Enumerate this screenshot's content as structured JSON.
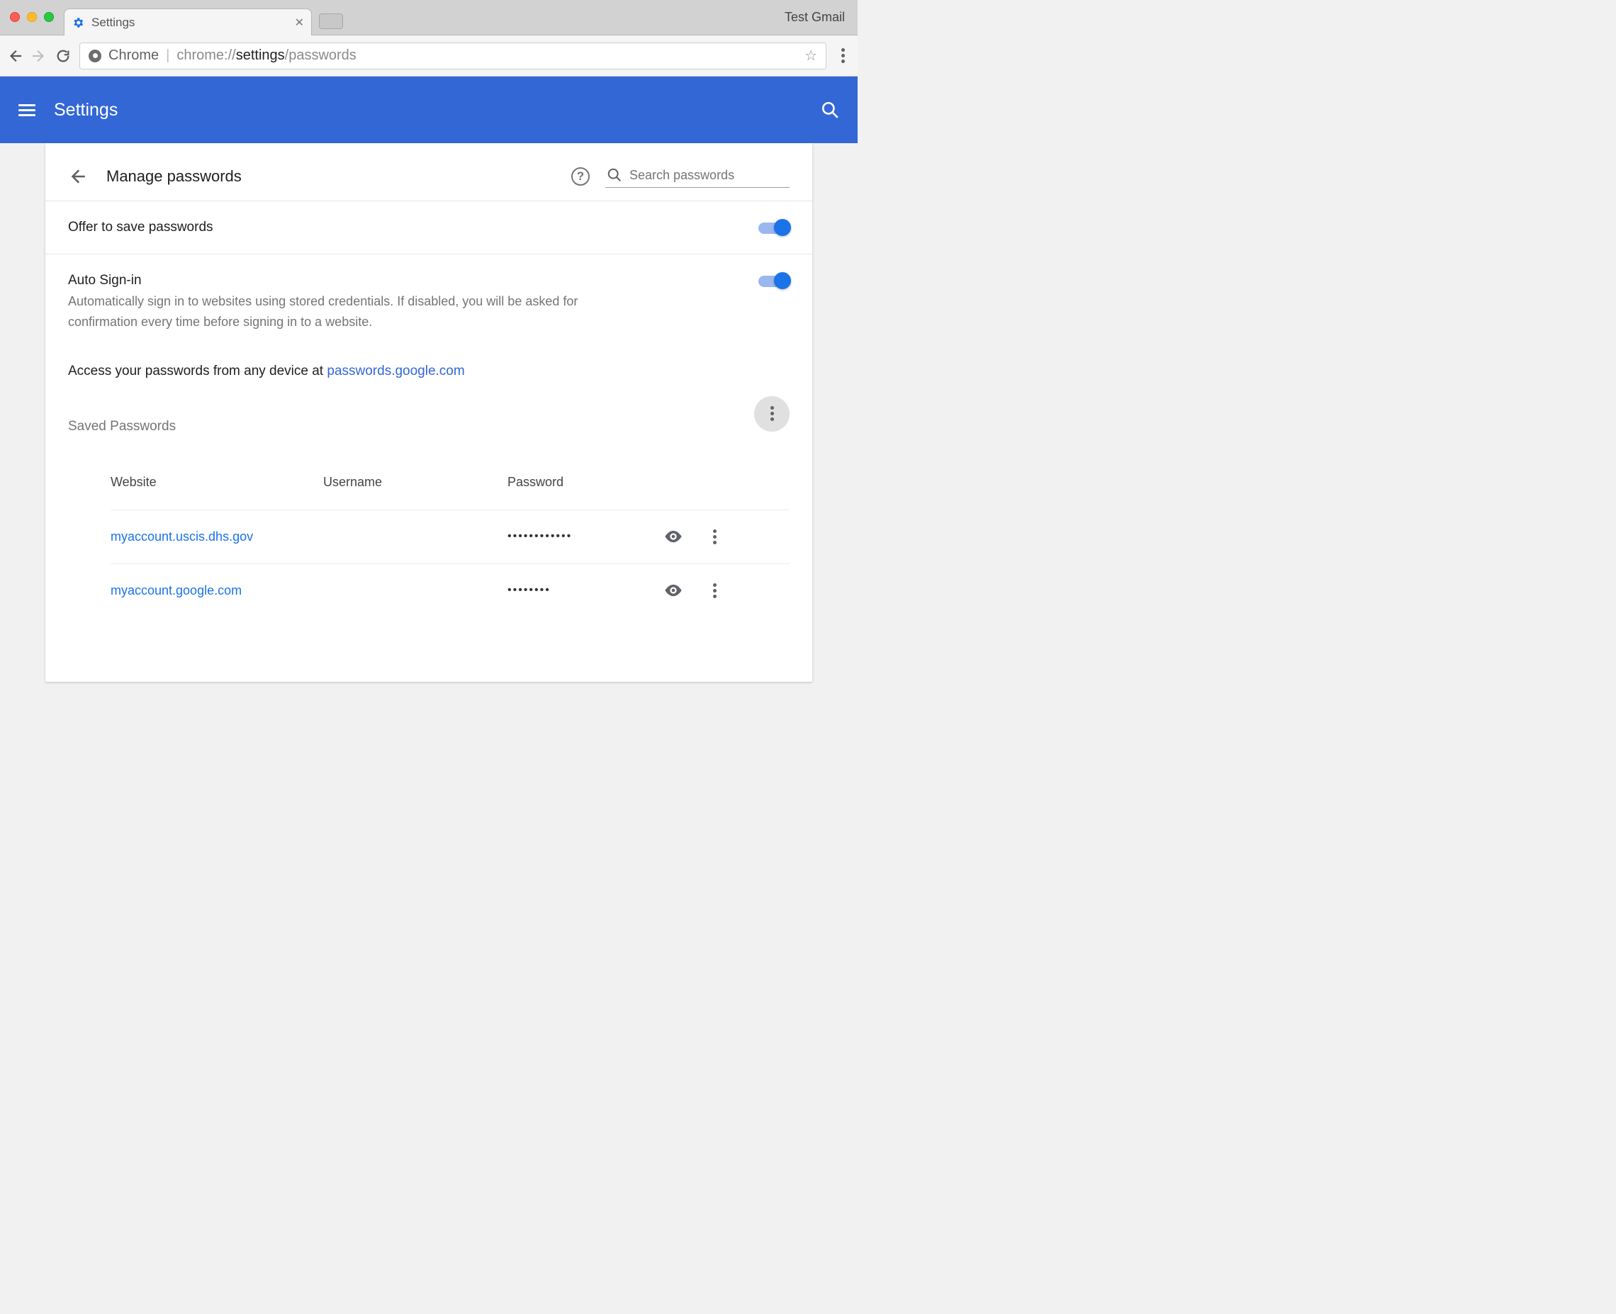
{
  "window": {
    "tab_title": "Settings",
    "profile": "Test Gmail"
  },
  "toolbar": {
    "scheme_chip": "Chrome",
    "url_gray1": "chrome://",
    "url_strong": "settings",
    "url_gray2": "/passwords"
  },
  "header": {
    "title": "Settings"
  },
  "section": {
    "title": "Manage passwords",
    "search_placeholder": "Search passwords"
  },
  "rows": {
    "offer": {
      "title": "Offer to save passwords"
    },
    "autosign": {
      "title": "Auto Sign-in",
      "sub": "Automatically sign in to websites using stored credentials. If disabled, you will be asked for confirmation every time before signing in to a website."
    },
    "access": {
      "prefix": "Access your passwords from any device at ",
      "link": "passwords.google.com"
    }
  },
  "saved": {
    "heading": "Saved Passwords",
    "cols": {
      "site": "Website",
      "user": "Username",
      "pw": "Password"
    },
    "rows": [
      {
        "site": "myaccount.uscis.dhs.gov",
        "user": "",
        "mask": "••••••••••••"
      },
      {
        "site": "myaccount.google.com",
        "user": "",
        "mask": "••••••••"
      }
    ]
  }
}
